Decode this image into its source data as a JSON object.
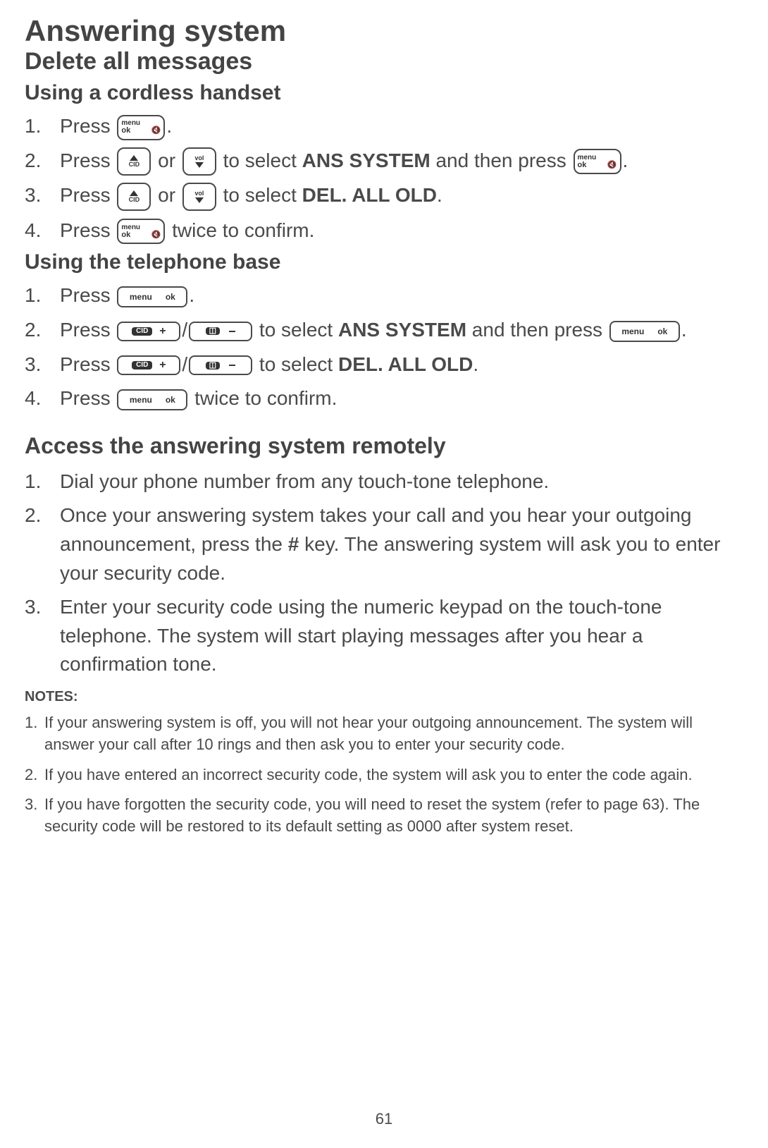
{
  "page_number": "61",
  "title": "Answering system",
  "section1": {
    "heading": "Delete all messages",
    "sub1": {
      "heading": "Using a cordless handset",
      "steps": [
        {
          "pre": "Press ",
          "post": "."
        },
        {
          "pre": "Press ",
          "mid1": " or ",
          "mid2": " to select ",
          "bold1": "ANS SYSTEM",
          "mid3": " and then press ",
          "post": "."
        },
        {
          "pre": "Press ",
          "mid1": " or ",
          "mid2": " to select ",
          "bold1": "DEL. ALL OLD",
          "post": "."
        },
        {
          "pre": "Press ",
          "post": " twice to confirm."
        }
      ]
    },
    "sub2": {
      "heading": "Using the telephone base",
      "steps": [
        {
          "pre": "Press ",
          "post": "."
        },
        {
          "pre": "Press ",
          "slash": "/",
          "mid2": " to select ",
          "bold1": "ANS SYSTEM",
          "mid3": " and then press ",
          "post": "."
        },
        {
          "pre": "Press ",
          "slash": "/",
          "mid2": " to select ",
          "bold1": "DEL. ALL OLD",
          "post": "."
        },
        {
          "pre": "Press ",
          "post": " twice to confirm."
        }
      ]
    }
  },
  "section2": {
    "heading": "Access the answering system remotely",
    "steps": [
      "Dial your phone number from any touch-tone telephone.",
      {
        "pre": "Once your answering system takes your call and you hear your outgoing announcement, press the ",
        "bold": "#",
        "post": " key. The answering system will ask you to enter your security code."
      },
      "Enter your security code using the numeric keypad on the touch-tone telephone. The system will start playing messages after you hear a confirmation tone."
    ]
  },
  "notes": {
    "heading": "NOTES:",
    "items": [
      "If your answering system is off, you will not hear your outgoing announcement. The system will answer your call after 10 rings and then ask you to enter your security code.",
      "If you have entered an incorrect security code, the system will ask you to enter the code again.",
      "If you have forgotten the security code, you will need to reset the system (refer to page 63). The security code will be restored to its default setting as 0000 after system reset."
    ]
  },
  "icons": {
    "menu_top": "menu",
    "ok_label": "ok",
    "cid_label": "CID",
    "vol_label": "vol",
    "base_menu": "menu",
    "base_ok": "ok",
    "cid_pill": "CID",
    "plus": "+",
    "minus": "−",
    "book": "▯▯"
  }
}
